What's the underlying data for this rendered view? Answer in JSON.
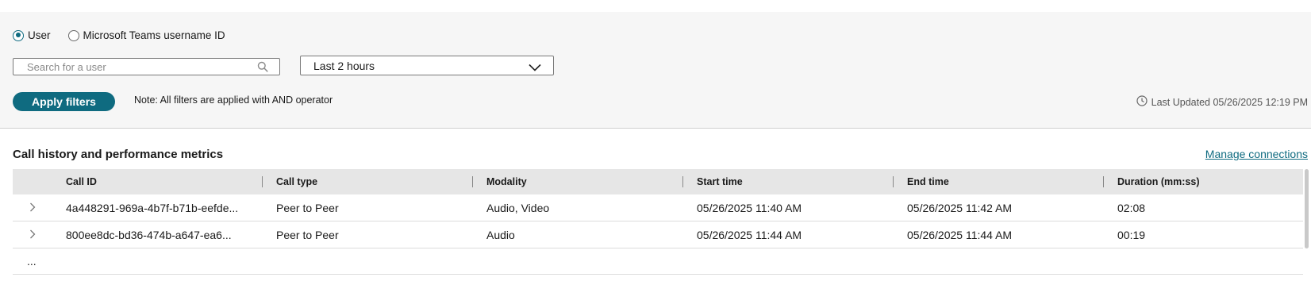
{
  "filters": {
    "radio_options": [
      {
        "label": "User",
        "checked": true
      },
      {
        "label": "Microsoft Teams username ID",
        "checked": false
      }
    ],
    "search": {
      "placeholder": "Search for a user",
      "value": ""
    },
    "time_range": {
      "selected": "Last 2 hours"
    },
    "apply_label": "Apply filters",
    "note": "Note: All filters are applied with AND operator",
    "last_updated": "Last Updated 05/26/2025 12:19 PM"
  },
  "section": {
    "title": "Call history and performance metrics",
    "manage_link": "Manage connections"
  },
  "table": {
    "columns": [
      "Call ID",
      "Call type",
      "Modality",
      "Start time",
      "End time",
      "Duration (mm:ss)"
    ],
    "rows": [
      [
        "4a448291-969a-4b7f-b71b-eefde...",
        "Peer to Peer",
        "Audio, Video",
        "05/26/2025 11:40 AM",
        "05/26/2025 11:42 AM",
        "02:08"
      ],
      [
        "800ee8dc-bd36-474b-a647-ea6...",
        "Peer to Peer",
        "Audio",
        "05/26/2025 11:44 AM",
        "05/26/2025 11:44 AM",
        "00:19"
      ]
    ],
    "more_label": "..."
  },
  "colors": {
    "accent": "#0f6b80",
    "panel_bg": "#f6f6f6",
    "header_bg": "#e6e6e6"
  }
}
